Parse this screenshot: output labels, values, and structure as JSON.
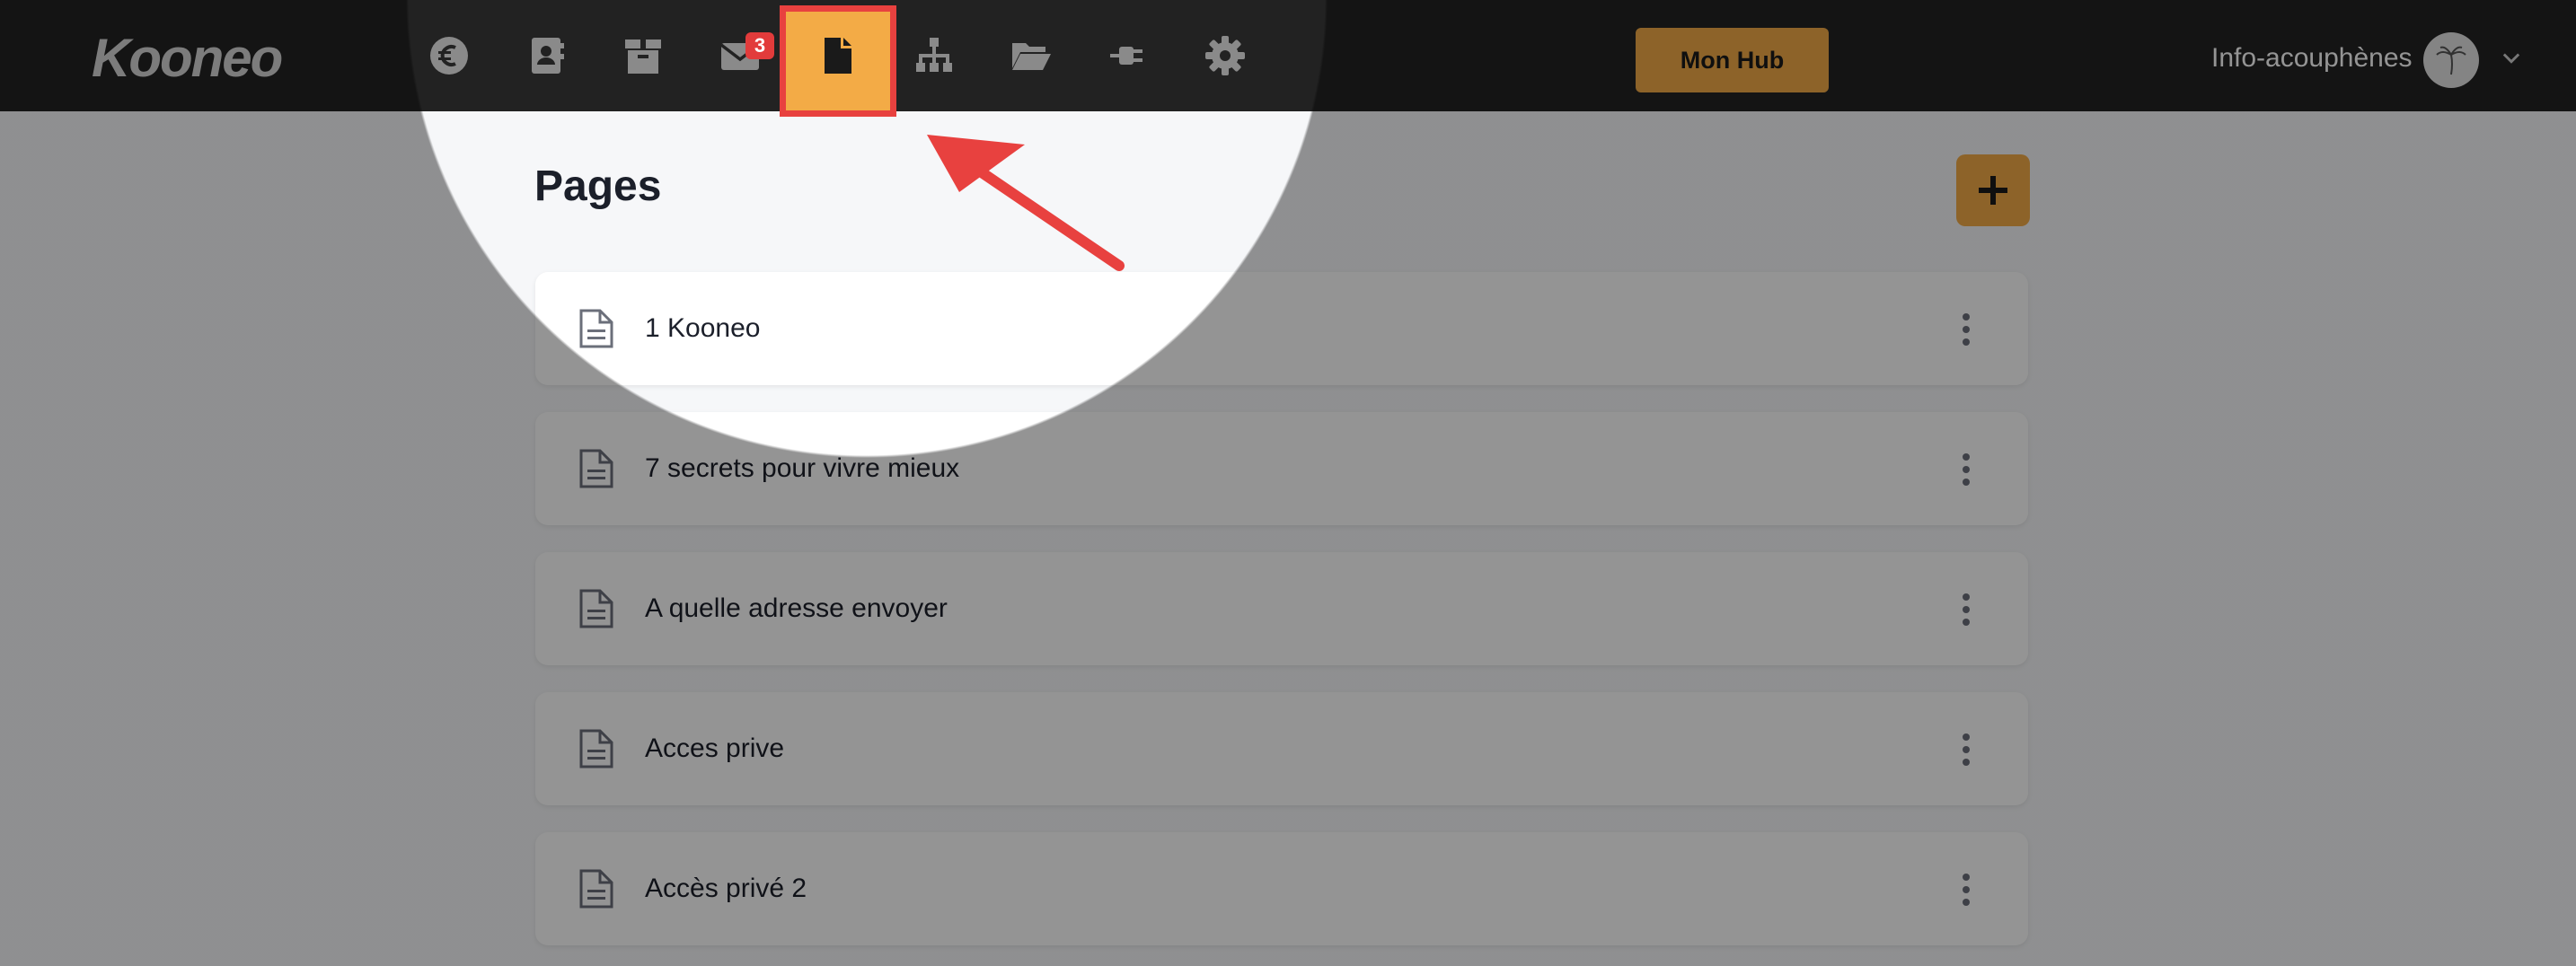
{
  "app": {
    "logo": "Kooneo"
  },
  "nav": {
    "items": [
      {
        "name": "euro"
      },
      {
        "name": "contacts"
      },
      {
        "name": "products"
      },
      {
        "name": "mail",
        "badge": "3"
      },
      {
        "name": "pages",
        "active": true
      },
      {
        "name": "sitemap"
      },
      {
        "name": "folder"
      },
      {
        "name": "plugins"
      },
      {
        "name": "settings"
      }
    ]
  },
  "header": {
    "hub_label": "Mon Hub",
    "account_name": "Info-acouphènes"
  },
  "main": {
    "title": "Pages",
    "items": [
      {
        "label": "1 Kooneo"
      },
      {
        "label": "7 secrets pour vivre mieux"
      },
      {
        "label": "A quelle adresse envoyer"
      },
      {
        "label": "Acces prive"
      },
      {
        "label": "Accès privé 2"
      }
    ]
  },
  "colors": {
    "accent": "#f3ab46",
    "highlight": "#e8413f",
    "topbar": "#222222",
    "badge": "#e23b3b"
  }
}
